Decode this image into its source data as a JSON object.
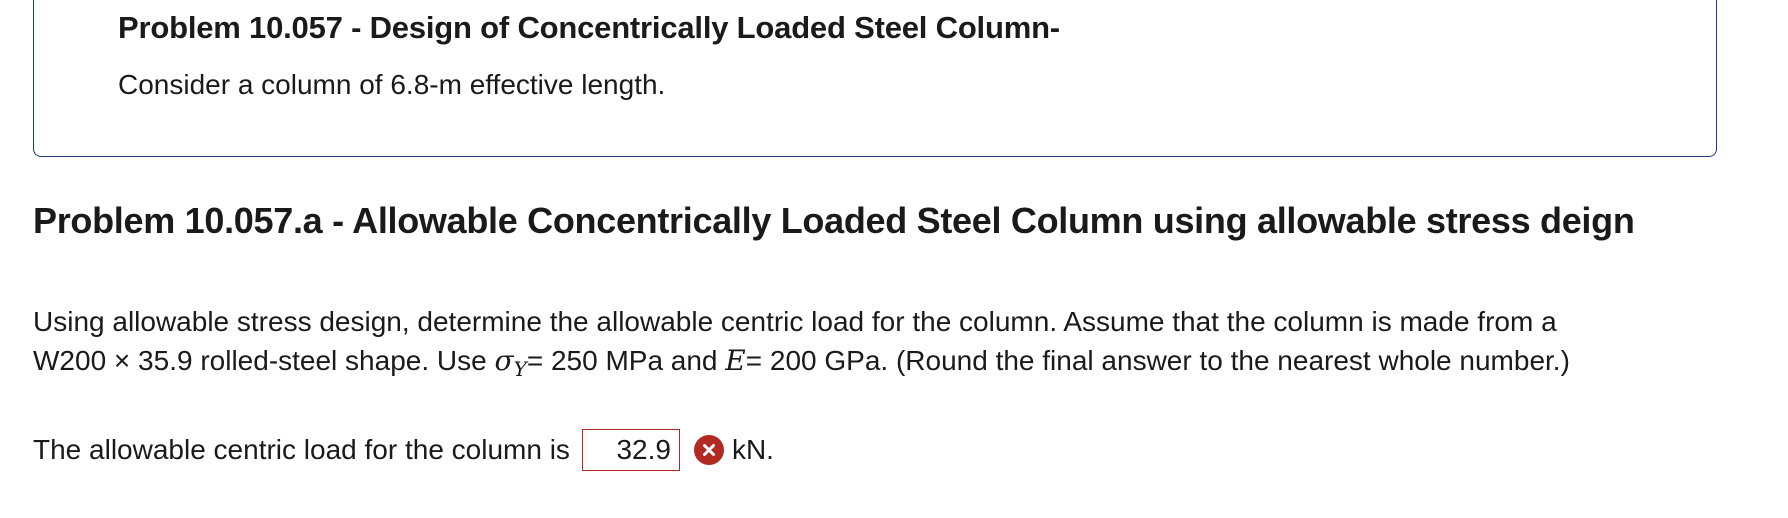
{
  "intro": {
    "title": "Problem 10.057 - Design of Concentrically Loaded Steel Column-",
    "text": "Consider a column of 6.8-m effective length."
  },
  "part": {
    "title": "Problem 10.057.a - Allowable Concentrically Loaded Steel Column using allowable stress deign"
  },
  "statement": {
    "line1": "Using allowable stress design, determine the allowable centric load for the column. Assume that the column is made from a",
    "line2_a": "W200 × 35.9 rolled-steel shape. Use ",
    "sigma": "σ",
    "sigma_sub": "Y",
    "line2_b": "= 250 MPa and ",
    "e_symbol": "E",
    "line2_c": "= 200 GPa. (Round the final answer to the nearest whole number.)"
  },
  "answer": {
    "prompt": "The allowable centric load for the column is",
    "value": "32.9",
    "status_icon": "incorrect-x-icon",
    "status_color": "#b22a22",
    "unit": "kN."
  }
}
